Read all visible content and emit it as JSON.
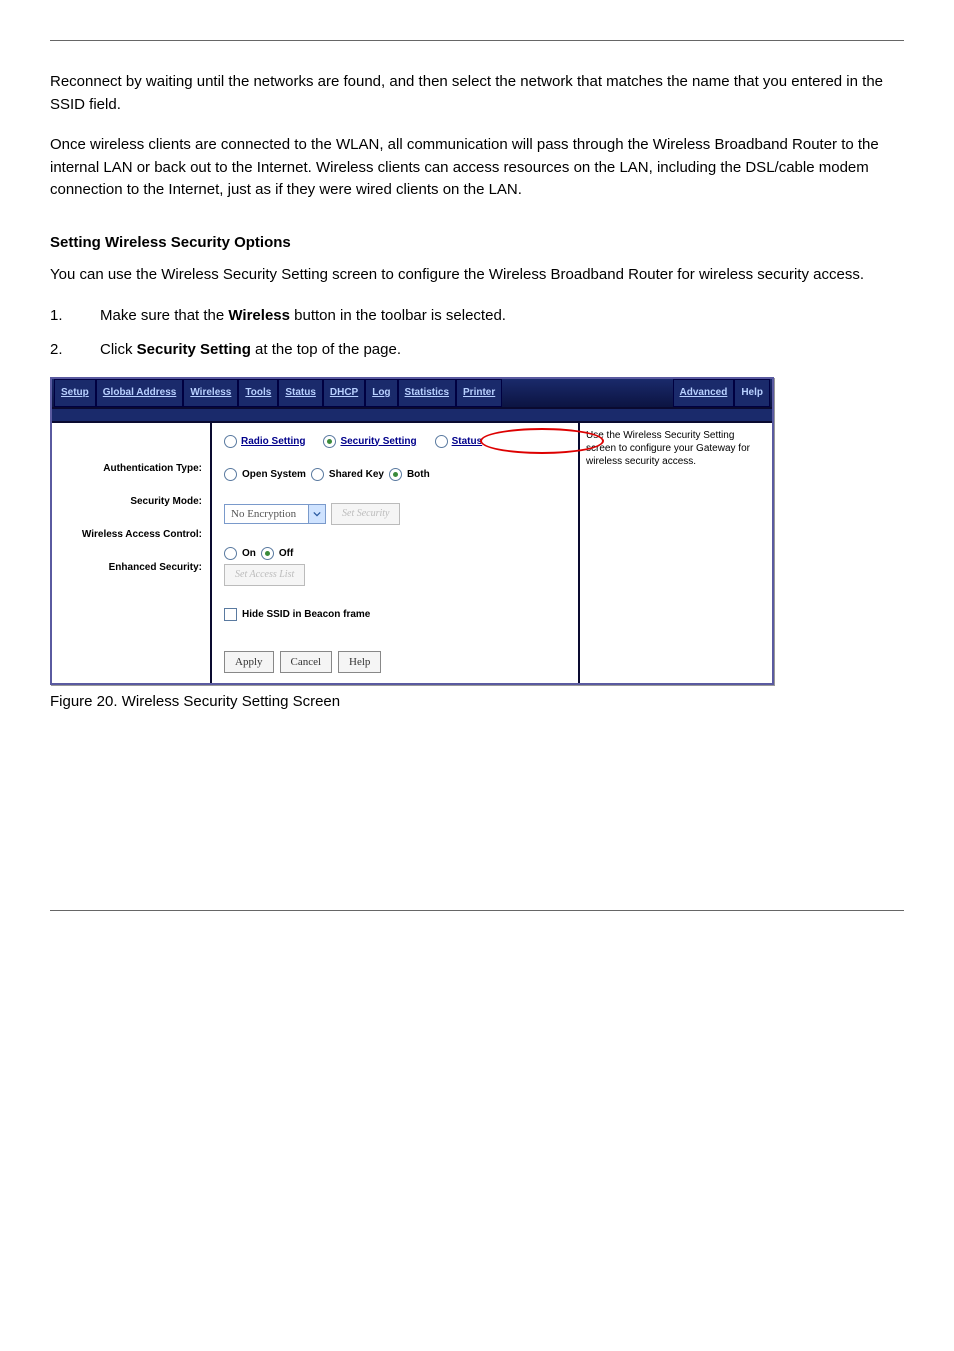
{
  "doc": {
    "para1": "Reconnect by waiting until the networks are found, and then select the network that matches the name that you entered in the SSID field.",
    "para2": "Once wireless clients are connected to the WLAN, all communication will pass through the Wireless Broadband Router to the internal LAN or back out to the Internet. Wireless clients can access resources on the LAN, including the DSL/cable modem connection to the Internet, just as if they were wired clients on the LAN.",
    "section_title": "Setting Wireless Security Options",
    "para3": "You can use the Wireless Security Setting screen to configure the Wireless Broadband Router for wireless security access.",
    "step1_n": "1.",
    "step1_a": "Make sure that the ",
    "step1_b": "Wireless",
    "step1_c": " button in the toolbar is selected.",
    "step2_n": "2.",
    "step2_a": "Click ",
    "step2_b": "Security Setting",
    "step2_c": " at the top of the page.",
    "fig_caption": "Figure 20. Wireless Security Setting Screen"
  },
  "nav": {
    "setup": "Setup",
    "global": "Global Address",
    "wireless": "Wireless",
    "tools": "Tools",
    "status": "Status",
    "dhcp": "DHCP",
    "log": "Log",
    "stats": "Statistics",
    "printer": "Printer",
    "advanced": "Advanced",
    "help": "Help"
  },
  "subtabs": {
    "radio": "Radio Setting",
    "security": "Security Setting",
    "status": "Status"
  },
  "form": {
    "auth_label": "Authentication Type:",
    "auth_open": "Open System",
    "auth_shared": "Shared Key",
    "auth_both": "Both",
    "secmode_label": "Security Mode:",
    "secmode_value": "No Encryption",
    "secmode_btn": "Set Security",
    "wac_label": "Wireless Access Control:",
    "wac_on": "On",
    "wac_off": "Off",
    "wac_btn": "Set Access List",
    "enh_label": "Enhanced Security:",
    "enh_text": "Hide SSID in Beacon frame",
    "apply": "Apply",
    "cancel": "Cancel",
    "helpb": "Help"
  },
  "helptext": "Use the Wireless Security Setting screen to configure your Gateway for wireless security access."
}
